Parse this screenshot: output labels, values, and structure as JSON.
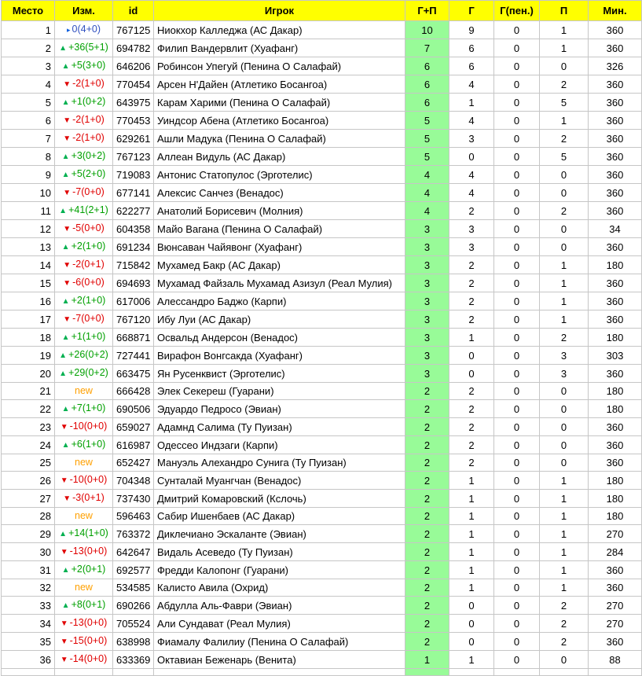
{
  "colors": {
    "header_bg": "#ffff00",
    "gp_bg": "#98fb98",
    "up": "#00a000",
    "down": "#e00000",
    "new": "#ffa000",
    "same": "#3050c0"
  },
  "headers": [
    "Место",
    "Изм.",
    "id",
    "Игрок",
    "Г+П",
    "Г",
    "Г(пен.)",
    "П",
    "Мин."
  ],
  "rows": [
    {
      "place": "1",
      "dir": "same",
      "change": "0(4+0)",
      "id": "767125",
      "player": "Ниокхор Калледжа (АС Дакар)",
      "gp": "10",
      "g": "9",
      "pen": "0",
      "p": "1",
      "min": "360"
    },
    {
      "place": "2",
      "dir": "up",
      "change": "+36(5+1)",
      "id": "694782",
      "player": "Филип Вандервлит (Хуафанг)",
      "gp": "7",
      "g": "6",
      "pen": "0",
      "p": "1",
      "min": "360"
    },
    {
      "place": "3",
      "dir": "up",
      "change": "+5(3+0)",
      "id": "646206",
      "player": "Робинсон Упегуй (Пенина О Салафай)",
      "gp": "6",
      "g": "6",
      "pen": "0",
      "p": "0",
      "min": "326"
    },
    {
      "place": "4",
      "dir": "down",
      "change": "-2(1+0)",
      "id": "770454",
      "player": "Арсен Н'Дайен (Атлетико Босангоа)",
      "gp": "6",
      "g": "4",
      "pen": "0",
      "p": "2",
      "min": "360"
    },
    {
      "place": "5",
      "dir": "up",
      "change": "+1(0+2)",
      "id": "643975",
      "player": "Карам Харими (Пенина О Салафай)",
      "gp": "6",
      "g": "1",
      "pen": "0",
      "p": "5",
      "min": "360"
    },
    {
      "place": "6",
      "dir": "down",
      "change": "-2(1+0)",
      "id": "770453",
      "player": "Уиндсор Абена (Атлетико Босангоа)",
      "gp": "5",
      "g": "4",
      "pen": "0",
      "p": "1",
      "min": "360"
    },
    {
      "place": "7",
      "dir": "down",
      "change": "-2(1+0)",
      "id": "629261",
      "player": "Ашли Мадука (Пенина О Салафай)",
      "gp": "5",
      "g": "3",
      "pen": "0",
      "p": "2",
      "min": "360"
    },
    {
      "place": "8",
      "dir": "up",
      "change": "+3(0+2)",
      "id": "767123",
      "player": "Аллеан Видуль (АС Дакар)",
      "gp": "5",
      "g": "0",
      "pen": "0",
      "p": "5",
      "min": "360"
    },
    {
      "place": "9",
      "dir": "up",
      "change": "+5(2+0)",
      "id": "719083",
      "player": "Антонис Статопулос (Эрготелис)",
      "gp": "4",
      "g": "4",
      "pen": "0",
      "p": "0",
      "min": "360"
    },
    {
      "place": "10",
      "dir": "down",
      "change": "-7(0+0)",
      "id": "677141",
      "player": "Алексис Санчез (Венадос)",
      "gp": "4",
      "g": "4",
      "pen": "0",
      "p": "0",
      "min": "360"
    },
    {
      "place": "11",
      "dir": "up",
      "change": "+41(2+1)",
      "id": "622277",
      "player": "Анатолий Борисевич (Молния)",
      "gp": "4",
      "g": "2",
      "pen": "0",
      "p": "2",
      "min": "360"
    },
    {
      "place": "12",
      "dir": "down",
      "change": "-5(0+0)",
      "id": "604358",
      "player": "Майо Вагана (Пенина О Салафай)",
      "gp": "3",
      "g": "3",
      "pen": "0",
      "p": "0",
      "min": "34"
    },
    {
      "place": "13",
      "dir": "up",
      "change": "+2(1+0)",
      "id": "691234",
      "player": "Вюнсаван Чайявонг (Хуафанг)",
      "gp": "3",
      "g": "3",
      "pen": "0",
      "p": "0",
      "min": "360"
    },
    {
      "place": "14",
      "dir": "down",
      "change": "-2(0+1)",
      "id": "715842",
      "player": "Мухамед Бакр (АС Дакар)",
      "gp": "3",
      "g": "2",
      "pen": "0",
      "p": "1",
      "min": "180"
    },
    {
      "place": "15",
      "dir": "down",
      "change": "-6(0+0)",
      "id": "694693",
      "player": "Мухамад Файзаль Мухамад Азизул (Реал Мулия)",
      "gp": "3",
      "g": "2",
      "pen": "0",
      "p": "1",
      "min": "360"
    },
    {
      "place": "16",
      "dir": "up",
      "change": "+2(1+0)",
      "id": "617006",
      "player": "Алессандро Баджо (Карпи)",
      "gp": "3",
      "g": "2",
      "pen": "0",
      "p": "1",
      "min": "360"
    },
    {
      "place": "17",
      "dir": "down",
      "change": "-7(0+0)",
      "id": "767120",
      "player": "Ибу Луи (АС Дакар)",
      "gp": "3",
      "g": "2",
      "pen": "0",
      "p": "1",
      "min": "360"
    },
    {
      "place": "18",
      "dir": "up",
      "change": "+1(1+0)",
      "id": "668871",
      "player": "Освальд Андерсон (Венадос)",
      "gp": "3",
      "g": "1",
      "pen": "0",
      "p": "2",
      "min": "180"
    },
    {
      "place": "19",
      "dir": "up",
      "change": "+26(0+2)",
      "id": "727441",
      "player": "Вирафон Вонгсакда (Хуафанг)",
      "gp": "3",
      "g": "0",
      "pen": "0",
      "p": "3",
      "min": "303"
    },
    {
      "place": "20",
      "dir": "up",
      "change": "+29(0+2)",
      "id": "663475",
      "player": "Ян Русенквист (Эрготелис)",
      "gp": "3",
      "g": "0",
      "pen": "0",
      "p": "3",
      "min": "360"
    },
    {
      "place": "21",
      "dir": "new",
      "change": "new",
      "id": "666428",
      "player": "Элек Секереш (Гуарани)",
      "gp": "2",
      "g": "2",
      "pen": "0",
      "p": "0",
      "min": "180"
    },
    {
      "place": "22",
      "dir": "up",
      "change": "+7(1+0)",
      "id": "690506",
      "player": "Эдуардо Педросо (Эвиан)",
      "gp": "2",
      "g": "2",
      "pen": "0",
      "p": "0",
      "min": "180"
    },
    {
      "place": "23",
      "dir": "down",
      "change": "-10(0+0)",
      "id": "659027",
      "player": "Адамнд Салима (Ту Пуизан)",
      "gp": "2",
      "g": "2",
      "pen": "0",
      "p": "0",
      "min": "360"
    },
    {
      "place": "24",
      "dir": "up",
      "change": "+6(1+0)",
      "id": "616987",
      "player": "Одессео Индзаги (Карпи)",
      "gp": "2",
      "g": "2",
      "pen": "0",
      "p": "0",
      "min": "360"
    },
    {
      "place": "25",
      "dir": "new",
      "change": "new",
      "id": "652427",
      "player": "Мануэль Алехандро Сунига (Ту Пуизан)",
      "gp": "2",
      "g": "2",
      "pen": "0",
      "p": "0",
      "min": "360"
    },
    {
      "place": "26",
      "dir": "down",
      "change": "-10(0+0)",
      "id": "704348",
      "player": "Сунталай Муангчан (Венадос)",
      "gp": "2",
      "g": "1",
      "pen": "0",
      "p": "1",
      "min": "180"
    },
    {
      "place": "27",
      "dir": "down",
      "change": "-3(0+1)",
      "id": "737430",
      "player": "Дмитрий Комаровский (Кслочь)",
      "gp": "2",
      "g": "1",
      "pen": "0",
      "p": "1",
      "min": "180"
    },
    {
      "place": "28",
      "dir": "new",
      "change": "new",
      "id": "596463",
      "player": "Сабир Ишенбаев (АС Дакар)",
      "gp": "2",
      "g": "1",
      "pen": "0",
      "p": "1",
      "min": "180"
    },
    {
      "place": "29",
      "dir": "up",
      "change": "+14(1+0)",
      "id": "763372",
      "player": "Диклечиано Эскаланте (Эвиан)",
      "gp": "2",
      "g": "1",
      "pen": "0",
      "p": "1",
      "min": "270"
    },
    {
      "place": "30",
      "dir": "down",
      "change": "-13(0+0)",
      "id": "642647",
      "player": "Видаль Асеведо (Ту Пуизан)",
      "gp": "2",
      "g": "1",
      "pen": "0",
      "p": "1",
      "min": "284"
    },
    {
      "place": "31",
      "dir": "up",
      "change": "+2(0+1)",
      "id": "692577",
      "player": "Фредди Калопонг (Гуарани)",
      "gp": "2",
      "g": "1",
      "pen": "0",
      "p": "1",
      "min": "360"
    },
    {
      "place": "32",
      "dir": "new",
      "change": "new",
      "id": "534585",
      "player": "Калисто Авила (Охрид)",
      "gp": "2",
      "g": "1",
      "pen": "0",
      "p": "1",
      "min": "360"
    },
    {
      "place": "33",
      "dir": "up",
      "change": "+8(0+1)",
      "id": "690266",
      "player": "Абдулла Аль-Фаври (Эвиан)",
      "gp": "2",
      "g": "0",
      "pen": "0",
      "p": "2",
      "min": "270"
    },
    {
      "place": "34",
      "dir": "down",
      "change": "-13(0+0)",
      "id": "705524",
      "player": "Али Сундават (Реал Мулия)",
      "gp": "2",
      "g": "0",
      "pen": "0",
      "p": "2",
      "min": "270"
    },
    {
      "place": "35",
      "dir": "down",
      "change": "-15(0+0)",
      "id": "638998",
      "player": "Фиамалу Фалилиу (Пенина О Салафай)",
      "gp": "2",
      "g": "0",
      "pen": "0",
      "p": "2",
      "min": "360"
    },
    {
      "place": "36",
      "dir": "down",
      "change": "-14(0+0)",
      "id": "633369",
      "player": "Октавиан Беженарь (Венита)",
      "gp": "1",
      "g": "1",
      "pen": "0",
      "p": "0",
      "min": "88"
    }
  ]
}
